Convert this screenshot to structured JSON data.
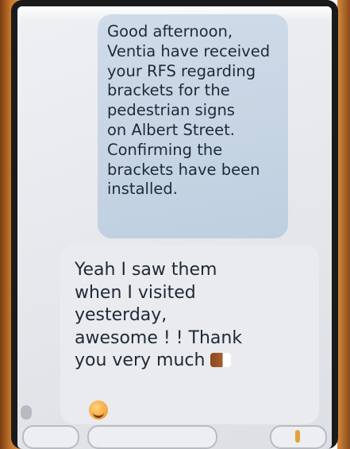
{
  "messages": {
    "incoming": {
      "text": "Good afternoon,\nVentia have received\nyour RFS regarding\nbrackets for the\npedestrian signs\non Albert Street.\nConfirming the\nbrackets have been\ninstalled."
    },
    "outgoing": {
      "text": "Yeah I saw them\nwhen I visited\nyesterday,\nawesome ! !  Thank\nyou very much",
      "icons": [
        "thumbs-up-icon",
        "smile-icon"
      ]
    }
  },
  "colors": {
    "incoming_bubble": "#c6d5e4",
    "outgoing_bubble": "#e9ebee",
    "text": "#1f2a36",
    "wood": "#c7772c"
  }
}
